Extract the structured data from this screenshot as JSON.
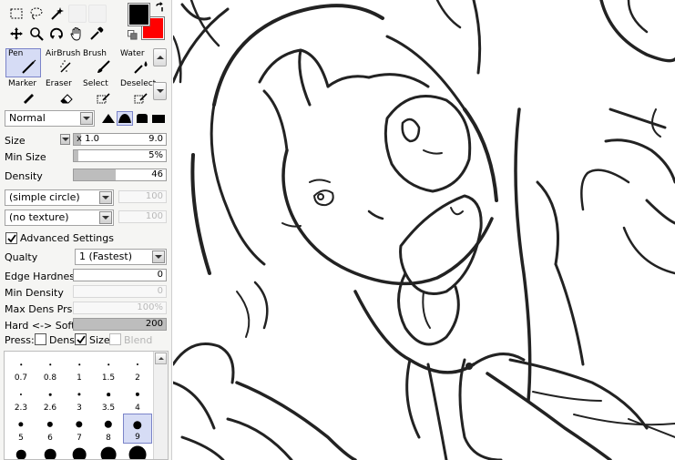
{
  "tools": {
    "row1": [
      "rect-select-icon",
      "lasso-icon",
      "magic-wand-icon"
    ],
    "row2": [
      "move-icon",
      "zoom-icon",
      "rotate-icon",
      "hand-icon",
      "eyedropper-icon"
    ]
  },
  "colors": {
    "primary": "#000000",
    "secondary": "#ff0000"
  },
  "brushes": [
    {
      "label": "Pen",
      "icon": "pen-icon",
      "selected": true
    },
    {
      "label": "AirBrush",
      "icon": "airbrush-icon",
      "selected": false
    },
    {
      "label": "Brush",
      "icon": "brush-icon",
      "selected": false
    },
    {
      "label": "Water",
      "icon": "water-icon",
      "selected": false
    },
    {
      "label": "Marker",
      "icon": "marker-icon",
      "selected": false
    },
    {
      "label": "Eraser",
      "icon": "eraser-icon",
      "selected": false
    },
    {
      "label": "Select",
      "icon": "select-brush-icon",
      "selected": false
    },
    {
      "label": "Deselect",
      "icon": "deselect-brush-icon",
      "selected": false
    }
  ],
  "blend_mode": "Normal",
  "settings": {
    "size_label": "Size",
    "size_multiplier": "x 1.0",
    "size_value": "9.0",
    "min_size_label": "Min Size",
    "min_size_value": "5%",
    "min_size_level": 0.05,
    "density_label": "Density",
    "density_value": "46",
    "density_level": 0.46,
    "shape_select": "(simple circle)",
    "shape_value": "100",
    "texture_select": "(no texture)",
    "texture_value": "100"
  },
  "advanced": {
    "checkbox_label": "Advanced Settings",
    "checked": true,
    "quality_label": "Qualty",
    "quality_value": "1 (Fastest)",
    "edge_hardness_label": "Edge Hardness",
    "edge_hardness_value": "0",
    "min_density_label": "Min Density",
    "min_density_value": "0",
    "max_dens_label": "Max Dens Prs.",
    "max_dens_value": "100%",
    "hard_soft_label": "Hard <-> Soft",
    "hard_soft_value": "200",
    "hard_soft_level": 1.0,
    "press_label": "Press:",
    "press_dens_label": "Dens",
    "press_dens_checked": false,
    "press_size_label": "Size",
    "press_size_checked": true,
    "press_blend_label": "Blend",
    "press_blend_checked": false
  },
  "brush_sizes": [
    {
      "label": "0.7",
      "dot": 1
    },
    {
      "label": "0.8",
      "dot": 1
    },
    {
      "label": "1",
      "dot": 1
    },
    {
      "label": "1.5",
      "dot": 1.5
    },
    {
      "label": "2",
      "dot": 2
    },
    {
      "label": "2.3",
      "dot": 2
    },
    {
      "label": "2.6",
      "dot": 2.5
    },
    {
      "label": "3",
      "dot": 3
    },
    {
      "label": "3.5",
      "dot": 3.5
    },
    {
      "label": "4",
      "dot": 4
    },
    {
      "label": "5",
      "dot": 5
    },
    {
      "label": "6",
      "dot": 6
    },
    {
      "label": "7",
      "dot": 7
    },
    {
      "label": "8",
      "dot": 8
    },
    {
      "label": "9",
      "dot": 9,
      "selected": true
    },
    {
      "label": "",
      "dot": 10
    },
    {
      "label": "",
      "dot": 12
    },
    {
      "label": "",
      "dot": 14
    },
    {
      "label": "",
      "dot": 16
    },
    {
      "label": "",
      "dot": 18
    }
  ]
}
